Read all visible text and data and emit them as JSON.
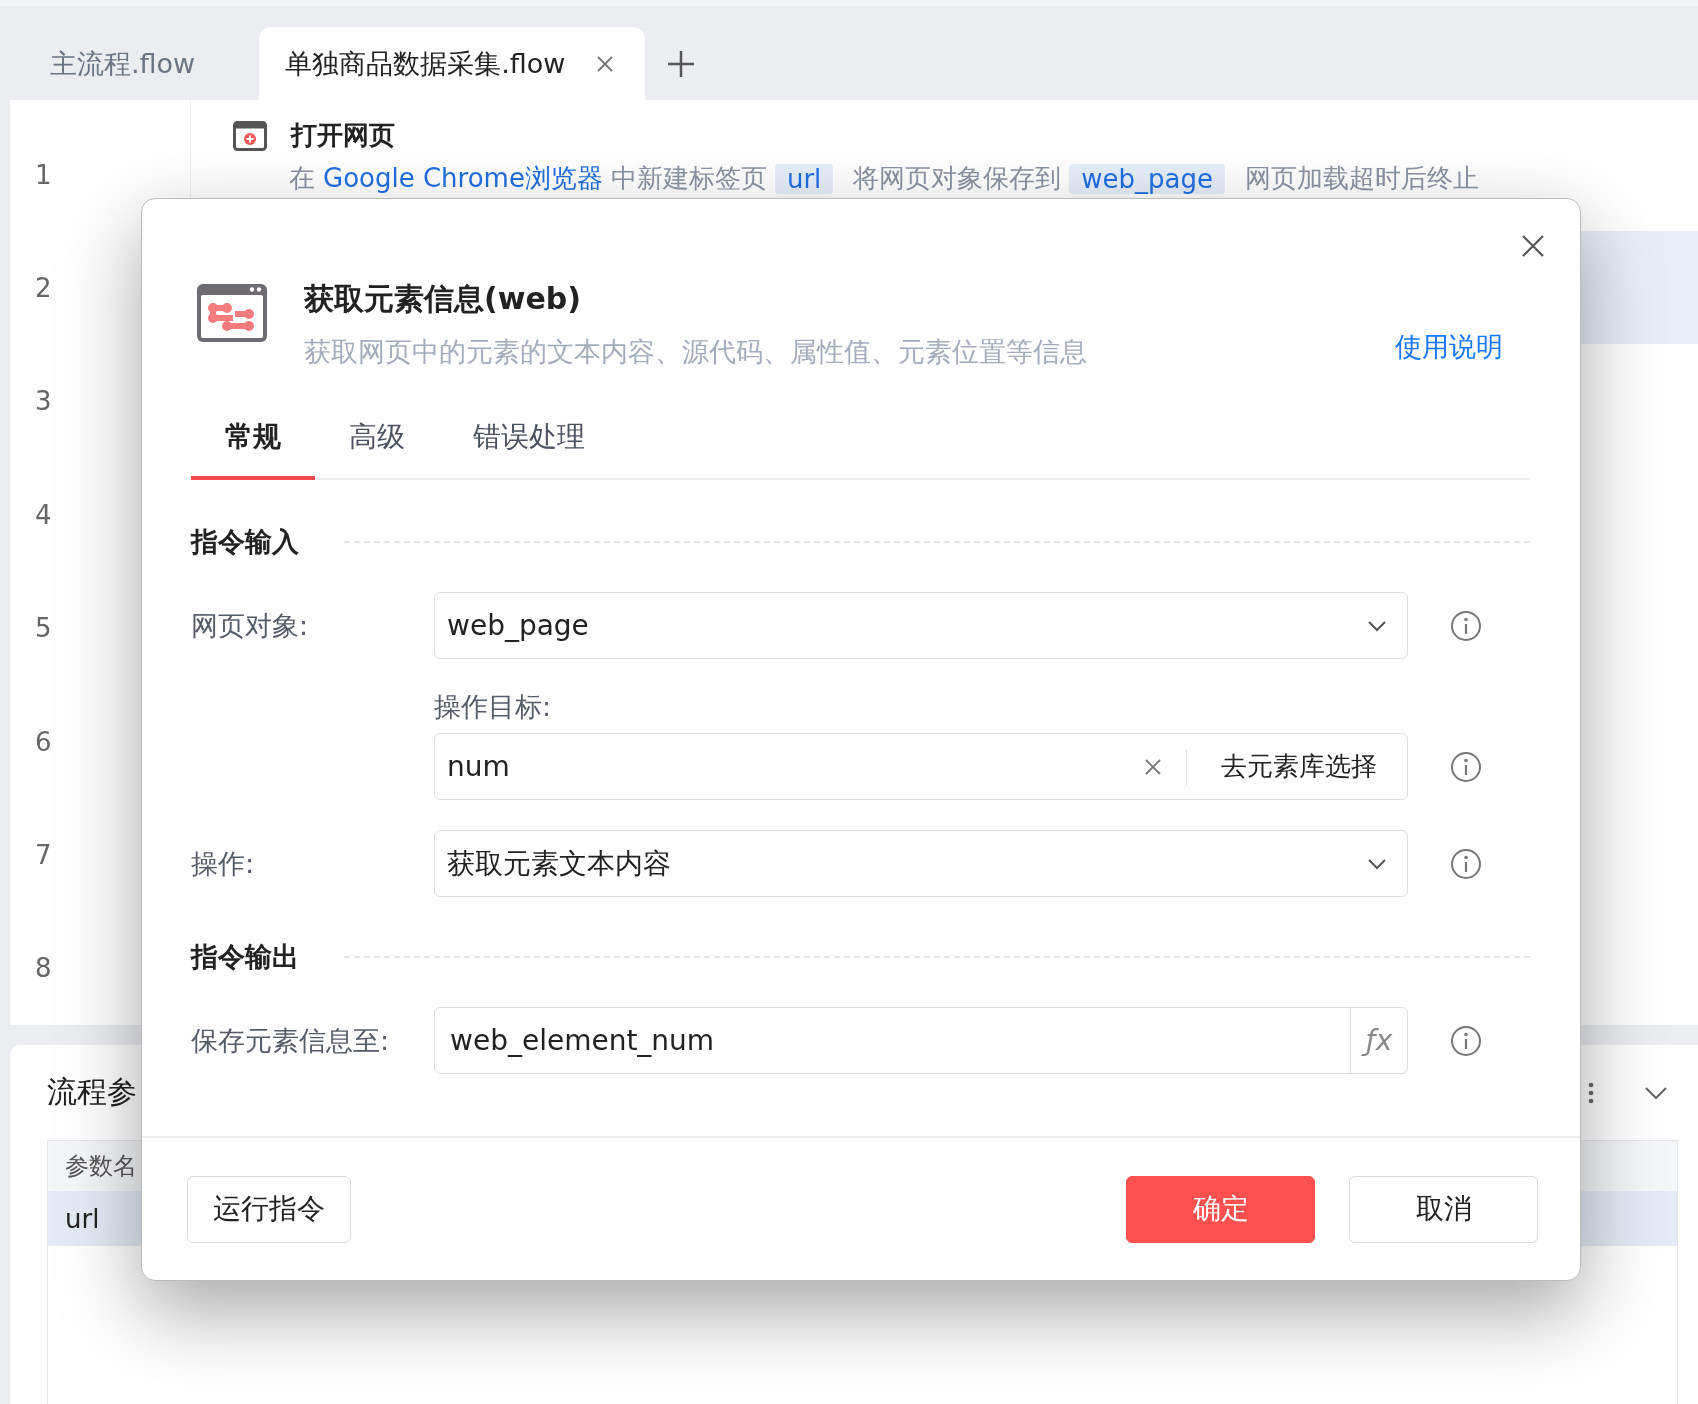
{
  "file_tabs": [
    {
      "label": "主流程.flow",
      "selected": false,
      "closable": false
    },
    {
      "label": "单独商品数据采集.flow",
      "selected": true,
      "closable": true
    }
  ],
  "editor": {
    "lines": [
      {
        "number": "1",
        "selected": false
      },
      {
        "number": "2",
        "selected": true
      },
      {
        "number": "3",
        "selected": false
      },
      {
        "number": "4",
        "selected": false
      },
      {
        "number": "5",
        "selected": false
      },
      {
        "number": "6",
        "selected": false
      },
      {
        "number": "7",
        "selected": false
      },
      {
        "number": "8",
        "selected": false
      }
    ],
    "step": {
      "title": "打开网页",
      "description": [
        {
          "kind": "text",
          "text": "在"
        },
        {
          "kind": "link",
          "text": "Google Chrome浏览器"
        },
        {
          "kind": "text",
          "text": "中新建标签页"
        },
        {
          "kind": "tag",
          "text": "url"
        },
        {
          "kind": "text",
          "text": "将网页对象保存到"
        },
        {
          "kind": "tag",
          "text": "web_page"
        },
        {
          "kind": "text",
          "text": "网页加载超时后终止"
        }
      ]
    }
  },
  "params_panel": {
    "title": "流程参",
    "columns": [
      "参数名"
    ],
    "rows": [
      {
        "cells": [
          "url"
        ],
        "selected": true
      }
    ]
  },
  "dialog": {
    "title": "获取元素信息(web)",
    "description": "获取网页中的元素的文本内容、源代码、属性值、元素位置等信息",
    "help_link": "使用说明",
    "tabs": [
      {
        "label": "常规",
        "selected": true
      },
      {
        "label": "高级",
        "selected": false
      },
      {
        "label": "错误处理",
        "selected": false
      }
    ],
    "sections": [
      {
        "title": "指令输入",
        "fields": [
          {
            "kind": "select",
            "label": "网页对象:",
            "value": "web_page"
          },
          {
            "kind": "target",
            "label": "操作目标:",
            "value": "num",
            "action": "去元素库选择"
          },
          {
            "kind": "select",
            "label": "操作:",
            "value": "获取元素文本内容"
          }
        ]
      },
      {
        "title": "指令输出",
        "fields": [
          {
            "kind": "variable",
            "label": "保存元素信息至:",
            "value": "web_element_num",
            "formula_button": "ƒx"
          }
        ]
      }
    ],
    "buttons": [
      {
        "label": "运行指令",
        "kind": "secondary"
      },
      {
        "label": "确定",
        "kind": "primary"
      },
      {
        "label": "取消",
        "kind": "secondary"
      }
    ]
  }
}
